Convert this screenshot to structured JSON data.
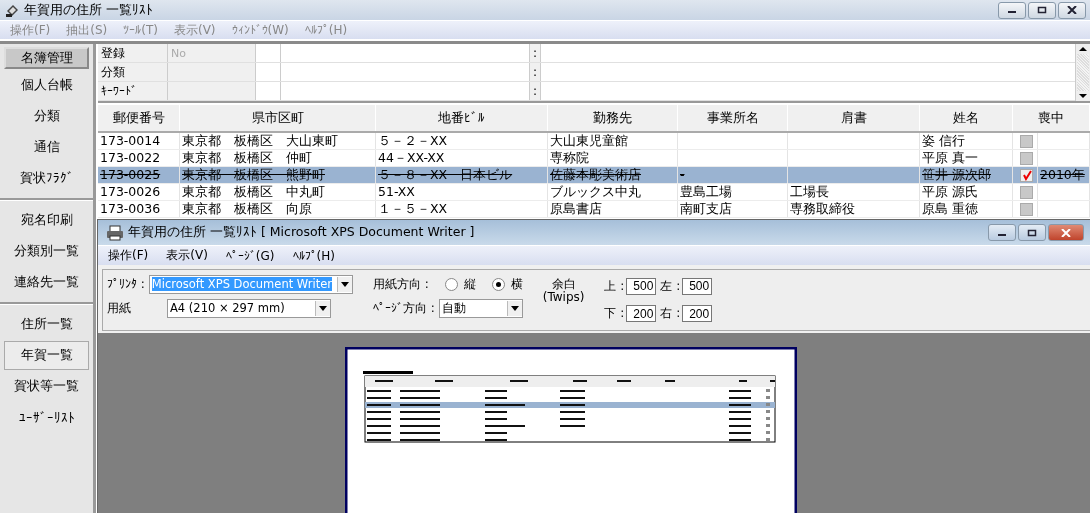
{
  "window": {
    "title": "年賀用の住所 一覧ﾘｽﾄ"
  },
  "menu": [
    "操作(F)",
    "抽出(S)",
    "ﾂｰﾙ(T)",
    "表示(V)",
    "ｳｨﾝﾄﾞｳ(W)",
    "ﾍﾙﾌﾟ(H)"
  ],
  "sidebar": {
    "groups": [
      [
        {
          "label": "名簿管理",
          "selected": true,
          "hover": false
        },
        {
          "label": "個人台帳",
          "selected": false,
          "hover": false
        },
        {
          "label": "分類",
          "selected": false,
          "hover": false
        },
        {
          "label": "通信",
          "selected": false,
          "hover": false
        },
        {
          "label": "賀状ﾌﾗｸﾞ",
          "selected": false,
          "hover": false
        }
      ],
      [
        {
          "label": "宛名印刷",
          "selected": false,
          "hover": false
        },
        {
          "label": "分類別一覧",
          "selected": false,
          "hover": false
        },
        {
          "label": "連絡先一覧",
          "selected": false,
          "hover": false
        }
      ],
      [
        {
          "label": "住所一覧",
          "selected": false,
          "hover": false
        },
        {
          "label": "年賀一覧",
          "selected": false,
          "hover": true
        },
        {
          "label": "賀状等一覧",
          "selected": false,
          "hover": false
        },
        {
          "label": "ﾕｰｻﾞｰﾘｽﾄ",
          "selected": false,
          "hover": false
        }
      ]
    ]
  },
  "filters": [
    {
      "label": "登録",
      "placeholder": "No",
      "separator": ":"
    },
    {
      "label": "分類",
      "separator": ":"
    },
    {
      "label": "ｷｰﾜｰﾄﾞ",
      "separator": ":"
    }
  ],
  "table": {
    "columns": [
      "郵便番号",
      "県市区町",
      "地番ﾋﾞﾙ",
      "勤務先",
      "事業所名",
      "肩書",
      "姓名",
      "喪中"
    ],
    "rows": [
      {
        "cells": [
          "173-0014",
          "東京都　板橋区　大山東町",
          "５－２－XX",
          "大山東児童館",
          "",
          "",
          "姿 信行"
        ],
        "mourning": false,
        "year": "",
        "deleted": false,
        "selected": false
      },
      {
        "cells": [
          "173-0022",
          "東京都　板橋区　仲町",
          "44－XX-XX",
          "専称院",
          "",
          "",
          "平原 真一"
        ],
        "mourning": false,
        "year": "",
        "deleted": false,
        "selected": false
      },
      {
        "cells": [
          "173-0025",
          "東京都　板橋区　熊野町",
          "５－８－XX　日本ビル",
          "佐藤本彫美術店",
          "-",
          "",
          "笹井 源次郎"
        ],
        "mourning": true,
        "year": "2010年",
        "deleted": true,
        "selected": true
      },
      {
        "cells": [
          "173-0026",
          "東京都　板橋区　中丸町",
          "51-XX",
          "ブルックス中丸",
          "豊島工場",
          "工場長",
          "平原 源氏"
        ],
        "mourning": false,
        "year": "",
        "deleted": false,
        "selected": false
      },
      {
        "cells": [
          "173-0036",
          "東京都　板橋区　向原",
          "１－５－XX",
          "原島書店",
          "南町支店",
          "専務取締役",
          "原島 重徳"
        ],
        "mourning": false,
        "year": "",
        "deleted": false,
        "selected": false
      }
    ]
  },
  "print_window": {
    "title": "年賀用の住所 一覧ﾘｽﾄ [ Microsoft XPS Document Writer ]",
    "menu": [
      "操作(F)",
      "表示(V)",
      "ﾍﾟｰｼﾞ(G)",
      "ﾍﾙﾌﾟ(H)"
    ],
    "printer": {
      "label": "ﾌﾟﾘﾝﾀ :",
      "value": "Microsoft XPS Document Writer"
    },
    "paper": {
      "label": "用紙",
      "value": "A4 (210 × 297 mm)"
    },
    "orientation": {
      "label": "用紙方向 :",
      "options": [
        {
          "label": "縦",
          "selected": false
        },
        {
          "label": "横",
          "selected": true
        }
      ]
    },
    "page_direction": {
      "label": "ﾍﾟｰｼﾞ方向 :",
      "value": "自動"
    },
    "margin": {
      "label": "余白",
      "unit": "(Twips)",
      "fields": [
        {
          "label": "上 :",
          "value": "500"
        },
        {
          "label": "左 :",
          "value": "500"
        },
        {
          "label": "下 :",
          "value": "200"
        },
        {
          "label": "右 :",
          "value": "200"
        }
      ]
    }
  }
}
